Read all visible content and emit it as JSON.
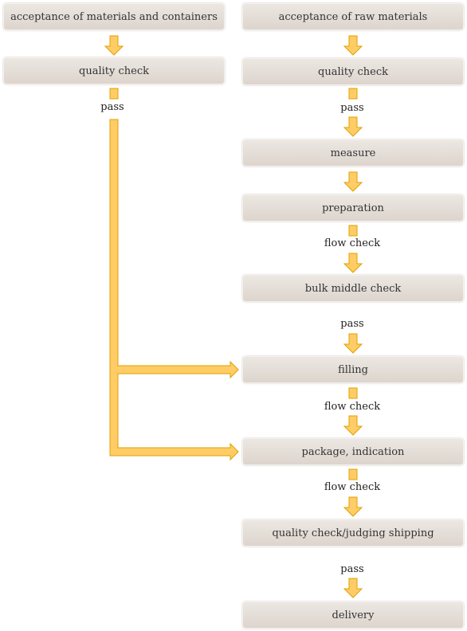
{
  "colors": {
    "arrow_fill": "#ffcc66",
    "arrow_stroke": "#e0a000",
    "box_top": "#ece7e2",
    "box_bottom": "#ddd5cd"
  },
  "left_flow": {
    "steps": [
      "acceptance of materials and containers",
      "quality check"
    ],
    "labels": [
      "pass"
    ]
  },
  "right_flow": {
    "steps": [
      "acceptance of raw materials",
      "quality check",
      "measure",
      "preparation",
      "bulk middle check",
      "filling",
      "package, indication",
      "quality check/judging shipping",
      "delivery"
    ],
    "labels": [
      "pass",
      "flow check",
      "pass",
      "flow check",
      "flow check",
      "pass"
    ]
  }
}
